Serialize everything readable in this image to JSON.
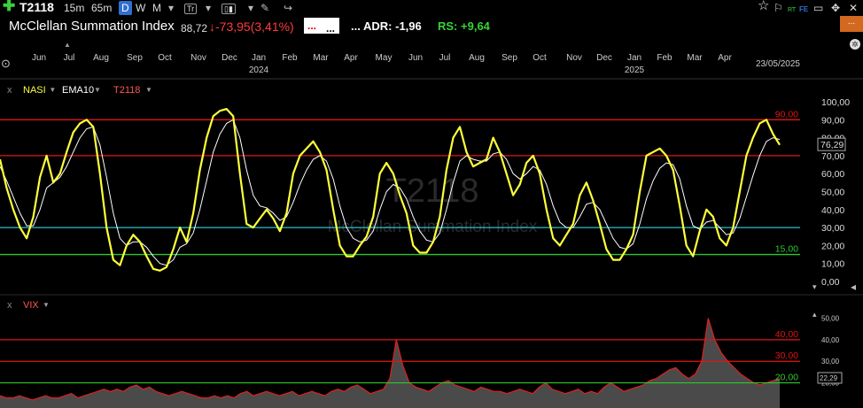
{
  "colors": {
    "accent_blue": "#2f6fd0",
    "up_green": "#3ad13a",
    "down_red": "#ff3b3b",
    "nasi_yellow": "#ffff3a",
    "level_red": "#e01515",
    "level_cyan": "#29c0d0",
    "level_green": "#2ec82e"
  },
  "toolbar": {
    "symbol": "T2118",
    "tf_15m": "15m",
    "tf_65m": "65m",
    "tf_d": "D",
    "tf_w": "W",
    "tf_m": "M",
    "icons": [
      "add-icon",
      "settings-icon",
      "chart-type-icon",
      "pencil-icon",
      "refresh-icon",
      "share-icon",
      "star-icon",
      "flag-icon",
      "rt-icon",
      "dual-window-icon",
      "move-icon",
      "close-icon"
    ],
    "rt_label": "RT",
    "fe_label": "FE"
  },
  "info": {
    "title": "McClellan Summation Index",
    "last": "88,72",
    "change": "-73,95",
    "change_pct": "(3,41%)",
    "box1": "...",
    "box2": "...",
    "adr_prefix": "...",
    "adr_label": "ADR:",
    "adr_value": "-1,96",
    "rs_label": "RS:",
    "rs_value": "+9,64",
    "menu": "..."
  },
  "xaxis": {
    "months": [
      "Jun",
      "Jul",
      "Aug",
      "Sep",
      "Oct",
      "Nov",
      "Dec",
      "Jan",
      "Feb",
      "Mar",
      "Apr",
      "May",
      "Jun",
      "Jul",
      "Aug",
      "Sep",
      "Oct",
      "Nov",
      "Dec",
      "Jan",
      "Feb",
      "Mar",
      "Apr"
    ],
    "years": [
      "2024",
      "2025"
    ],
    "date": "23/05/2025"
  },
  "chart_data": [
    {
      "type": "line",
      "title": "NASI",
      "legend": [
        "NASI",
        "EMA10",
        "T2118"
      ],
      "watermark": [
        "T2118",
        "McClellan Summation Index"
      ],
      "yticks": [
        "100,00",
        "90,00",
        "80,00",
        "70,00",
        "60,00",
        "50,00",
        "40,00",
        "30,00",
        "20,00",
        "10,00",
        "0,00"
      ],
      "ylim": [
        0,
        100
      ],
      "levels": [
        {
          "value": 90,
          "label": "90,00",
          "color": "#e01515"
        },
        {
          "value": 70,
          "label": "",
          "color": "#e01515"
        },
        {
          "value": 30,
          "label": "",
          "color": "#29c0d0"
        },
        {
          "value": 15,
          "label": "15,00",
          "color": "#2ec82e"
        }
      ],
      "current_value": "76,29",
      "series": [
        {
          "name": "NASI",
          "values": [
            68,
            52,
            40,
            30,
            24,
            36,
            58,
            70,
            55,
            60,
            72,
            83,
            88,
            90,
            86,
            60,
            30,
            12,
            9,
            20,
            26,
            22,
            14,
            7,
            6,
            8,
            18,
            30,
            22,
            38,
            62,
            80,
            92,
            95,
            96,
            92,
            60,
            32,
            30,
            35,
            40,
            35,
            28,
            38,
            60,
            70,
            74,
            78,
            72,
            62,
            40,
            20,
            14,
            14,
            20,
            25,
            36,
            60,
            66,
            60,
            48,
            38,
            20,
            16,
            16,
            22,
            36,
            62,
            80,
            86,
            72,
            64,
            66,
            68,
            80,
            72,
            60,
            48,
            54,
            66,
            70,
            60,
            40,
            24,
            20,
            26,
            32,
            48,
            55,
            45,
            32,
            18,
            12,
            12,
            18,
            26,
            50,
            70,
            72,
            74,
            70,
            62,
            42,
            20,
            14,
            28,
            40,
            36,
            24,
            20,
            30,
            50,
            70,
            80,
            88,
            90,
            82,
            76
          ]
        },
        {
          "name": "EMA10",
          "values": [
            64,
            56,
            47,
            38,
            31,
            31,
            40,
            52,
            55,
            58,
            64,
            72,
            80,
            85,
            86,
            76,
            58,
            38,
            24,
            20,
            22,
            22,
            19,
            14,
            10,
            9,
            12,
            19,
            21,
            27,
            40,
            56,
            72,
            82,
            88,
            90,
            80,
            62,
            48,
            42,
            41,
            38,
            34,
            36,
            44,
            54,
            62,
            68,
            70,
            67,
            57,
            42,
            30,
            24,
            22,
            23,
            28,
            40,
            50,
            54,
            52,
            46,
            36,
            28,
            23,
            22,
            27,
            40,
            55,
            67,
            70,
            68,
            67,
            67,
            71,
            72,
            68,
            60,
            57,
            60,
            64,
            62,
            54,
            42,
            33,
            30,
            30,
            36,
            43,
            44,
            40,
            32,
            24,
            19,
            18,
            21,
            32,
            46,
            56,
            63,
            66,
            65,
            57,
            42,
            31,
            29,
            33,
            34,
            30,
            26,
            27,
            35,
            47,
            59,
            70,
            78,
            80,
            79
          ]
        }
      ]
    },
    {
      "type": "area",
      "title": "VIX",
      "legend": [
        "VIX"
      ],
      "yticks": [
        "50,00",
        "40,00",
        "30,00",
        "20,00"
      ],
      "ylim": [
        12,
        56
      ],
      "levels": [
        {
          "value": 40,
          "label": "40,00",
          "color": "#e01515"
        },
        {
          "value": 30,
          "label": "30,00",
          "color": "#e01515"
        },
        {
          "value": 20,
          "label": "20,00",
          "color": "#2ec82e"
        }
      ],
      "current_value": "22,29",
      "series": [
        {
          "name": "VIX",
          "values": [
            14,
            13,
            13,
            14,
            13,
            12,
            13,
            14,
            13,
            13,
            14,
            15,
            13,
            14,
            15,
            16,
            17,
            16,
            17,
            16,
            18,
            19,
            17,
            18,
            16,
            15,
            14,
            15,
            16,
            15,
            14,
            13,
            13,
            14,
            13,
            14,
            13,
            15,
            16,
            14,
            15,
            16,
            15,
            14,
            15,
            16,
            14,
            15,
            16,
            15,
            14,
            16,
            17,
            16,
            18,
            19,
            17,
            15,
            16,
            17,
            22,
            40,
            28,
            20,
            18,
            17,
            16,
            18,
            20,
            21,
            19,
            18,
            17,
            16,
            18,
            17,
            16,
            16,
            15,
            16,
            17,
            16,
            15,
            18,
            20,
            17,
            16,
            15,
            16,
            17,
            15,
            16,
            15,
            18,
            20,
            18,
            16,
            17,
            18,
            19,
            21,
            22,
            24,
            26,
            27,
            24,
            22,
            24,
            30,
            50,
            40,
            34,
            30,
            27,
            24,
            22,
            20,
            19,
            20,
            21,
            22
          ]
        }
      ]
    }
  ]
}
